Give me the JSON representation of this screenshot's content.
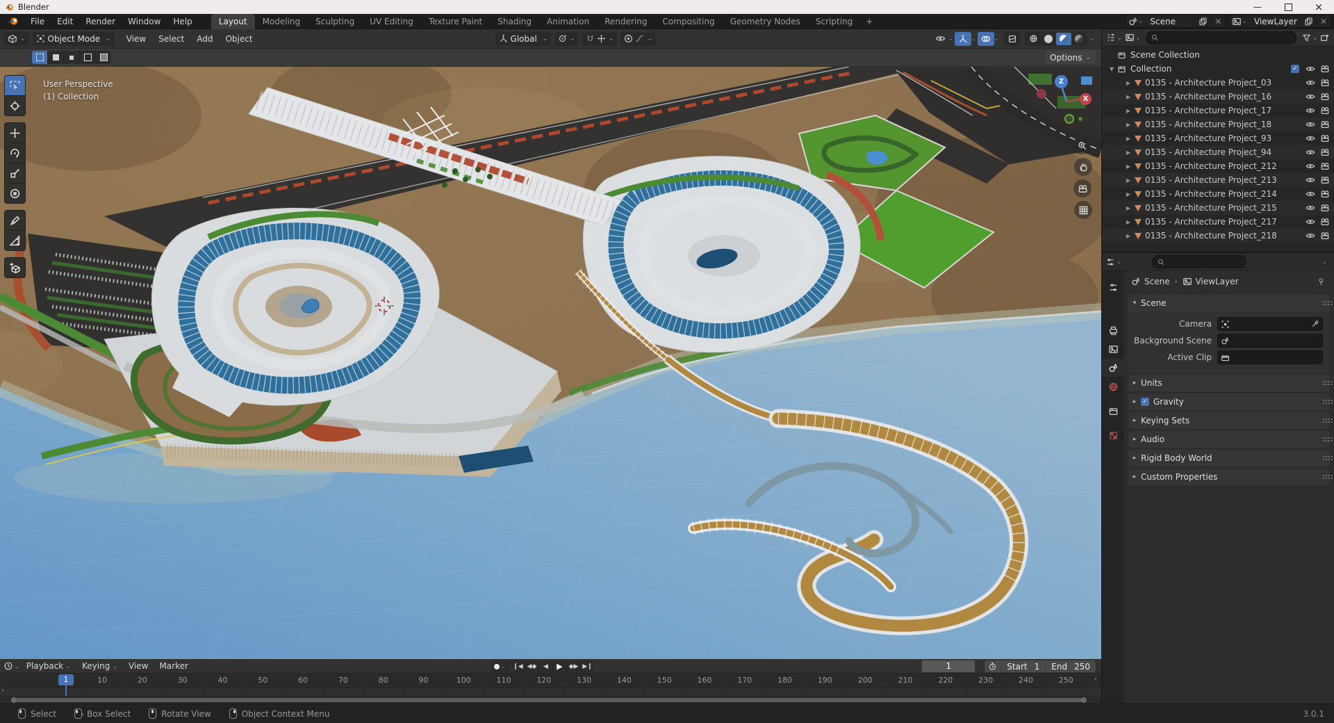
{
  "colors": {
    "accent": "#4772b3",
    "mesh_icon": "#cf8a5a",
    "water": "#7aa5c8",
    "terrain": "#8a6c49",
    "glass_blue": "#2e6f9b",
    "building_white": "#dcdfe2",
    "lawn_green": "#4f9e2e",
    "accent_red": "#b2503a",
    "axis_z": "#4a7fd0",
    "axis_x": "#c4454f",
    "axis_y": "#6da833"
  },
  "window": {
    "title": "Blender",
    "minimize": "—",
    "close": "×"
  },
  "topbar": {
    "menus": [
      "File",
      "Edit",
      "Render",
      "Window",
      "Help"
    ],
    "workspaces": [
      {
        "label": "Layout",
        "active": true
      },
      {
        "label": "Modeling"
      },
      {
        "label": "Sculpting"
      },
      {
        "label": "UV Editing"
      },
      {
        "label": "Texture Paint"
      },
      {
        "label": "Shading"
      },
      {
        "label": "Animation"
      },
      {
        "label": "Rendering"
      },
      {
        "label": "Compositing"
      },
      {
        "label": "Geometry Nodes"
      },
      {
        "label": "Scripting"
      }
    ],
    "new_workspace": "+",
    "scene_selector": {
      "value": "Scene"
    },
    "viewlayer_selector": {
      "value": "ViewLayer"
    }
  },
  "viewport": {
    "header": {
      "mode": "Object Mode",
      "menus": [
        {
          "label": "View"
        },
        {
          "label": "Select"
        },
        {
          "label": "Add"
        },
        {
          "label": "Object"
        }
      ],
      "orientation": "Global"
    },
    "tool_settings": {
      "options": "Options"
    },
    "overlay": {
      "line1": "User Perspective",
      "line2": "(1) Collection"
    },
    "gizmo": {
      "z": "Z",
      "x": "X"
    },
    "toolbar": [
      {
        "icon": "select",
        "active": true,
        "cls": "first"
      },
      {
        "icon": "cursor3d",
        "cls": "last"
      },
      {
        "icon": "move",
        "gap": true
      },
      {
        "icon": "rotate"
      },
      {
        "icon": "scaleic"
      },
      {
        "icon": "transform",
        "cls": "last"
      },
      {
        "icon": "annotate",
        "gap": true
      },
      {
        "icon": "measure",
        "cls": "last"
      },
      {
        "icon": "addcube",
        "gap": true,
        "cls": "solo"
      }
    ]
  },
  "outliner": {
    "root": "Scene Collection",
    "collection": "Collection",
    "items": [
      "0135 - Architecture Project_03",
      "0135 - Architecture Project_16",
      "0135 - Architecture Project_17",
      "0135 - Architecture Project_18",
      "0135 - Architecture Project_93",
      "0135 - Architecture Project_94",
      "0135 - Architecture Project_212",
      "0135 - Architecture Project_213",
      "0135 - Architecture Project_214",
      "0135 - Architecture Project_215",
      "0135 - Architecture Project_217",
      "0135 - Architecture Project_218"
    ]
  },
  "properties": {
    "breadcrumb": {
      "scene": "Scene",
      "viewlayer": "ViewLayer",
      "separator": "›"
    },
    "scene_panel": {
      "title": "Scene",
      "fields": [
        {
          "label": "Camera",
          "icon": "camobj",
          "extra": true
        },
        {
          "label": "Background Scene",
          "icon": "scene"
        },
        {
          "label": "Active Clip",
          "icon": "clip"
        }
      ]
    },
    "collapsed_panels": [
      {
        "title": "Units"
      },
      {
        "title": "Gravity",
        "checkbox": "✓"
      },
      {
        "title": "Keying Sets"
      },
      {
        "title": "Audio"
      },
      {
        "title": "Rigid Body World"
      },
      {
        "title": "Custom Properties"
      }
    ]
  },
  "timeline": {
    "menus": [
      {
        "label": "Playback",
        "caret": "⌄"
      },
      {
        "label": "Keying",
        "caret": "⌄"
      },
      {
        "label": "View"
      },
      {
        "label": "Marker"
      }
    ],
    "current_frame": "1",
    "start_label": "Start",
    "start_value": "1",
    "end_label": "End",
    "end_value": "250",
    "ruler_frames": [
      10,
      20,
      30,
      40,
      50,
      60,
      70,
      80,
      90,
      100,
      110,
      120,
      130,
      140,
      150,
      160,
      170,
      180,
      190,
      200,
      210,
      220,
      230,
      240,
      250
    ]
  },
  "statusbar": {
    "items": [
      {
        "label": "Select",
        "cls": "mouse-left"
      },
      {
        "label": "Box Select",
        "cls": "mouse-left-drag"
      },
      {
        "label": "Rotate View",
        "cls": "mouse-middle"
      },
      {
        "label": "Object Context Menu",
        "cls": "mouse-right"
      }
    ],
    "version": "3.0.1"
  }
}
